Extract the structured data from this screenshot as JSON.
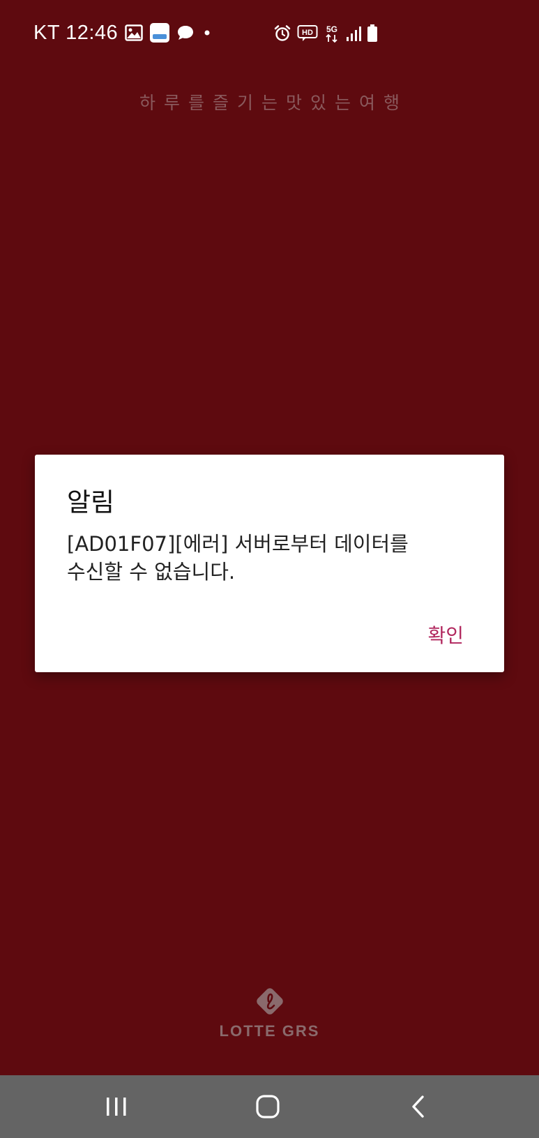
{
  "status_bar": {
    "carrier": "KT",
    "time": "12:46",
    "icons_left": [
      "gallery-icon",
      "pay-icon",
      "chat-bubble-icon",
      "dot-icon"
    ],
    "icons_right": [
      "alarm-icon",
      "hd-voice-icon",
      "5g-icon",
      "signal-icon",
      "battery-icon"
    ],
    "network_label": "5G",
    "hd_label": "HD"
  },
  "tagline": "하루를즐기는맛있는여행",
  "dialog": {
    "title": "알림",
    "message": "[AD01F07][에러] 서버로부터 데이터를\n수신할 수 없습니다.",
    "confirm_label": "확인"
  },
  "logo": {
    "text": "LOTTE GRS"
  },
  "navigation": {
    "buttons": [
      "recent-apps",
      "home",
      "back"
    ]
  },
  "colors": {
    "background": "#5e0a0f",
    "accent": "#b0255c",
    "nav_bar": "#646464"
  }
}
